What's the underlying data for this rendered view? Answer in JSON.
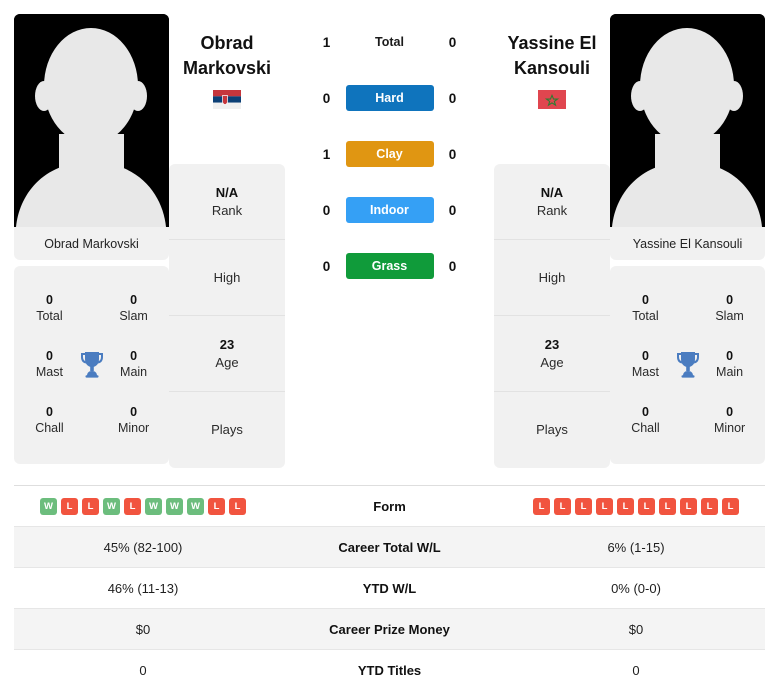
{
  "players": {
    "left": {
      "name_line1": "Obrad",
      "name_line2": "Markovski",
      "full_name": "Obrad Markovski",
      "flag": "serbia-flag",
      "avatar": "player-photo-placeholder",
      "rank_value": "N/A",
      "rank_label": "Rank",
      "high_value": "",
      "high_label": "High",
      "age_value": "23",
      "age_label": "Age",
      "plays_value": "",
      "plays_label": "Plays",
      "titles": {
        "total_value": "0",
        "total_label": "Total",
        "slam_value": "0",
        "slam_label": "Slam",
        "mast_value": "0",
        "mast_label": "Mast",
        "main_value": "0",
        "main_label": "Main",
        "chall_value": "0",
        "chall_label": "Chall",
        "minor_value": "0",
        "minor_label": "Minor",
        "trophy_icon": "trophy-icon"
      },
      "form": [
        "W",
        "L",
        "L",
        "W",
        "L",
        "W",
        "W",
        "W",
        "L",
        "L"
      ],
      "career_total_wl": "45% (82-100)",
      "ytd_wl": "46% (11-13)",
      "career_prize_money": "$0",
      "ytd_titles": "0"
    },
    "right": {
      "name_line1": "Yassine El",
      "name_line2": "Kansouli",
      "full_name": "Yassine El Kansouli",
      "flag": "morocco-flag",
      "avatar": "player-photo-placeholder",
      "rank_value": "N/A",
      "rank_label": "Rank",
      "high_value": "",
      "high_label": "High",
      "age_value": "23",
      "age_label": "Age",
      "plays_value": "",
      "plays_label": "Plays",
      "titles": {
        "total_value": "0",
        "total_label": "Total",
        "slam_value": "0",
        "slam_label": "Slam",
        "mast_value": "0",
        "mast_label": "Mast",
        "main_value": "0",
        "main_label": "Main",
        "chall_value": "0",
        "chall_label": "Chall",
        "minor_value": "0",
        "minor_label": "Minor",
        "trophy_icon": "trophy-icon"
      },
      "form": [
        "L",
        "L",
        "L",
        "L",
        "L",
        "L",
        "L",
        "L",
        "L",
        "L"
      ],
      "career_total_wl": "6% (1-15)",
      "ytd_wl": "0% (0-0)",
      "career_prize_money": "$0",
      "ytd_titles": "0"
    }
  },
  "head_to_head": [
    {
      "label": "Total",
      "left": "1",
      "right": "0",
      "style": "plain",
      "color": ""
    },
    {
      "label": "Hard",
      "left": "0",
      "right": "0",
      "style": "badge",
      "color": "#0f74bd"
    },
    {
      "label": "Clay",
      "left": "1",
      "right": "0",
      "style": "badge",
      "color": "#e09612"
    },
    {
      "label": "Indoor",
      "left": "0",
      "right": "0",
      "style": "badge",
      "color": "#35a0f5"
    },
    {
      "label": "Grass",
      "left": "0",
      "right": "0",
      "style": "badge",
      "color": "#109b3a"
    }
  ],
  "table_labels": {
    "form": "Form",
    "career_total_wl": "Career Total W/L",
    "ytd_wl": "YTD W/L",
    "career_prize_money": "Career Prize Money",
    "ytd_titles": "YTD Titles"
  },
  "colors": {
    "win_badge": "#6cbd7d",
    "loss_badge": "#f1543f",
    "card_bg": "#f1f1f1",
    "row_alt_bg": "#f4f4f4",
    "trophy": "#4a7cc0"
  }
}
